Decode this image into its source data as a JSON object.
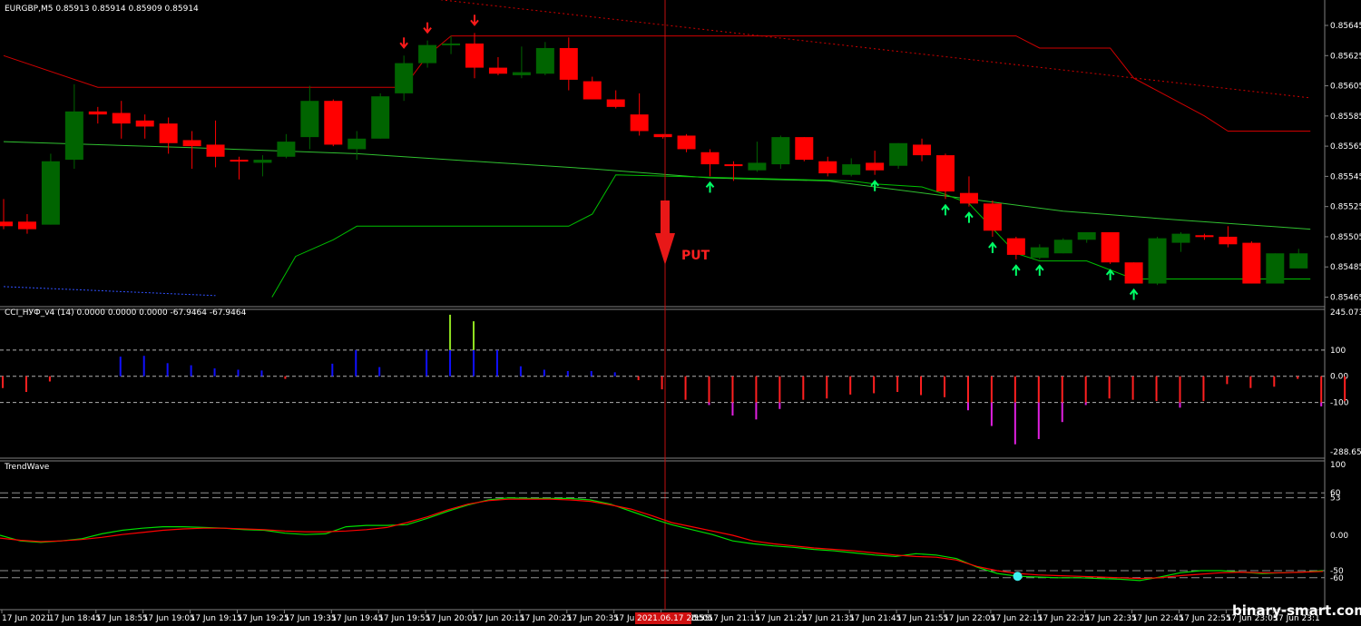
{
  "chart_data": [
    {
      "type": "candlestick",
      "title": "EURGBP,M5  0.85913 0.85914 0.85909 0.85914",
      "ylim": [
        0.85465,
        0.85645
      ],
      "y_ticks": [
        "0.85645",
        "0.85625",
        "0.85605",
        "0.85585",
        "0.85565",
        "0.85545",
        "0.85525",
        "0.85505",
        "0.85485",
        "0.85465"
      ],
      "colors": {
        "bull": "#006400",
        "bear": "#ff0000",
        "upper_band": "#d00000",
        "lower_band": "#00c000",
        "ma": "#30c030",
        "arrow_up": "#00ff66",
        "arrow_down": "#ff1a1a"
      },
      "candles": [
        {
          "o": 0.85515,
          "h": 0.8553,
          "l": 0.8551,
          "c": 0.85512
        },
        {
          "o": 0.85515,
          "h": 0.8552,
          "l": 0.85507,
          "c": 0.8551
        },
        {
          "o": 0.85513,
          "h": 0.8556,
          "l": 0.85513,
          "c": 0.85555
        },
        {
          "o": 0.85556,
          "h": 0.85606,
          "l": 0.8555,
          "c": 0.85588
        },
        {
          "o": 0.85588,
          "h": 0.85591,
          "l": 0.8558,
          "c": 0.85586
        },
        {
          "o": 0.85587,
          "h": 0.85595,
          "l": 0.8557,
          "c": 0.8558
        },
        {
          "o": 0.85582,
          "h": 0.85586,
          "l": 0.8557,
          "c": 0.85578
        },
        {
          "o": 0.8558,
          "h": 0.85584,
          "l": 0.8556,
          "c": 0.85567
        },
        {
          "o": 0.85569,
          "h": 0.85575,
          "l": 0.8555,
          "c": 0.85565
        },
        {
          "o": 0.85566,
          "h": 0.85582,
          "l": 0.85551,
          "c": 0.85558
        },
        {
          "o": 0.85556,
          "h": 0.85558,
          "l": 0.85543,
          "c": 0.85555
        },
        {
          "o": 0.85554,
          "h": 0.85559,
          "l": 0.85545,
          "c": 0.85556
        },
        {
          "o": 0.85558,
          "h": 0.85573,
          "l": 0.85557,
          "c": 0.85568
        },
        {
          "o": 0.85571,
          "h": 0.85605,
          "l": 0.85563,
          "c": 0.85595
        },
        {
          "o": 0.85595,
          "h": 0.85596,
          "l": 0.85565,
          "c": 0.85566
        },
        {
          "o": 0.85563,
          "h": 0.85575,
          "l": 0.85556,
          "c": 0.8557
        },
        {
          "o": 0.8557,
          "h": 0.856,
          "l": 0.8557,
          "c": 0.85598
        },
        {
          "o": 0.856,
          "h": 0.85625,
          "l": 0.85595,
          "c": 0.8562
        },
        {
          "o": 0.8562,
          "h": 0.85635,
          "l": 0.85617,
          "c": 0.85632
        },
        {
          "o": 0.85632,
          "h": 0.85638,
          "l": 0.85626,
          "c": 0.85633
        },
        {
          "o": 0.85633,
          "h": 0.8564,
          "l": 0.8561,
          "c": 0.85617
        },
        {
          "o": 0.85617,
          "h": 0.85624,
          "l": 0.85612,
          "c": 0.85613
        },
        {
          "o": 0.85612,
          "h": 0.85631,
          "l": 0.8561,
          "c": 0.85614
        },
        {
          "o": 0.85613,
          "h": 0.85634,
          "l": 0.85612,
          "c": 0.8563
        },
        {
          "o": 0.8563,
          "h": 0.85637,
          "l": 0.85602,
          "c": 0.85609
        },
        {
          "o": 0.85608,
          "h": 0.85611,
          "l": 0.85596,
          "c": 0.85596
        },
        {
          "o": 0.85596,
          "h": 0.85602,
          "l": 0.8559,
          "c": 0.85591
        },
        {
          "o": 0.85586,
          "h": 0.856,
          "l": 0.85572,
          "c": 0.85575
        },
        {
          "o": 0.85573,
          "h": 0.85573,
          "l": 0.8557,
          "c": 0.85571
        },
        {
          "o": 0.85572,
          "h": 0.85573,
          "l": 0.85561,
          "c": 0.85563
        },
        {
          "o": 0.85561,
          "h": 0.85563,
          "l": 0.85545,
          "c": 0.85553
        },
        {
          "o": 0.85553,
          "h": 0.85555,
          "l": 0.85542,
          "c": 0.85552
        },
        {
          "o": 0.85549,
          "h": 0.85568,
          "l": 0.85548,
          "c": 0.85554
        },
        {
          "o": 0.85553,
          "h": 0.85572,
          "l": 0.8555,
          "c": 0.85571
        },
        {
          "o": 0.85571,
          "h": 0.85571,
          "l": 0.85555,
          "c": 0.85556
        },
        {
          "o": 0.85555,
          "h": 0.85558,
          "l": 0.85545,
          "c": 0.85547
        },
        {
          "o": 0.85546,
          "h": 0.85557,
          "l": 0.85545,
          "c": 0.85553
        },
        {
          "o": 0.85554,
          "h": 0.85562,
          "l": 0.85546,
          "c": 0.85549
        },
        {
          "o": 0.85552,
          "h": 0.85567,
          "l": 0.8555,
          "c": 0.85567
        },
        {
          "o": 0.85566,
          "h": 0.8557,
          "l": 0.85555,
          "c": 0.85559
        },
        {
          "o": 0.85559,
          "h": 0.8556,
          "l": 0.8553,
          "c": 0.85535
        },
        {
          "o": 0.85534,
          "h": 0.85545,
          "l": 0.85525,
          "c": 0.85527
        },
        {
          "o": 0.85527,
          "h": 0.85529,
          "l": 0.85505,
          "c": 0.85509
        },
        {
          "o": 0.85504,
          "h": 0.85505,
          "l": 0.8549,
          "c": 0.85493
        },
        {
          "o": 0.85491,
          "h": 0.855,
          "l": 0.8549,
          "c": 0.85498
        },
        {
          "o": 0.85494,
          "h": 0.85504,
          "l": 0.85494,
          "c": 0.85503
        },
        {
          "o": 0.85503,
          "h": 0.85508,
          "l": 0.85501,
          "c": 0.85508
        },
        {
          "o": 0.85508,
          "h": 0.85508,
          "l": 0.85487,
          "c": 0.85488
        },
        {
          "o": 0.85488,
          "h": 0.85488,
          "l": 0.85474,
          "c": 0.85474
        },
        {
          "o": 0.85474,
          "h": 0.85505,
          "l": 0.85473,
          "c": 0.85504
        },
        {
          "o": 0.85501,
          "h": 0.85508,
          "l": 0.85495,
          "c": 0.85507
        },
        {
          "o": 0.85506,
          "h": 0.85507,
          "l": 0.85503,
          "c": 0.85505
        },
        {
          "o": 0.85505,
          "h": 0.85512,
          "l": 0.85498,
          "c": 0.855
        },
        {
          "o": 0.85501,
          "h": 0.85502,
          "l": 0.85474,
          "c": 0.85474
        },
        {
          "o": 0.85474,
          "h": 0.85494,
          "l": 0.85474,
          "c": 0.85494
        },
        {
          "o": 0.85484,
          "h": 0.85497,
          "l": 0.85484,
          "c": 0.85494
        }
      ],
      "upper_band": [
        [
          0,
          0.85625
        ],
        [
          4,
          0.85604
        ],
        [
          17,
          0.85604
        ],
        [
          18,
          0.85625
        ],
        [
          19,
          0.85638
        ],
        [
          43,
          0.85638
        ],
        [
          44,
          0.8563
        ],
        [
          47,
          0.8563
        ],
        [
          48,
          0.8561
        ],
        [
          51,
          0.85585
        ],
        [
          52,
          0.85575
        ],
        [
          55.5,
          0.85575
        ]
      ],
      "upper_dotted": [
        [
          18,
          0.85663
        ],
        [
          55.5,
          0.85597
        ]
      ],
      "lower_band": [
        [
          11.4,
          0.85465
        ],
        [
          12.4,
          0.85492
        ],
        [
          14,
          0.85503
        ],
        [
          15,
          0.85512
        ],
        [
          24,
          0.85512
        ],
        [
          25,
          0.8552
        ],
        [
          26,
          0.85546
        ],
        [
          36,
          0.85542
        ],
        [
          37,
          0.8554
        ],
        [
          39,
          0.85538
        ],
        [
          40,
          0.85533
        ],
        [
          41,
          0.85527
        ],
        [
          43,
          0.85494
        ],
        [
          44,
          0.85489
        ],
        [
          46,
          0.85489
        ],
        [
          48,
          0.85477
        ],
        [
          55.5,
          0.85477
        ]
      ],
      "ma_line": [
        [
          0,
          0.85568
        ],
        [
          8,
          0.85564
        ],
        [
          15,
          0.8556
        ],
        [
          20,
          0.85555
        ],
        [
          25,
          0.8555
        ],
        [
          30,
          0.85544
        ],
        [
          35,
          0.85542
        ],
        [
          40,
          0.85532
        ],
        [
          45,
          0.85522
        ],
        [
          50,
          0.85516
        ],
        [
          55.5,
          0.8551
        ]
      ],
      "blue_dotted": [
        [
          0,
          0.85472
        ],
        [
          9,
          0.85466
        ]
      ],
      "down_arrows": [
        17,
        18,
        20
      ],
      "up_arrows": [
        30,
        37,
        40,
        41,
        42,
        43,
        44,
        47,
        48
      ],
      "signal": {
        "label": "PUT",
        "x_index": 28
      }
    },
    {
      "type": "bar",
      "title": "CCI_НУФ_v4 (14) 0.0000 0.0000 0.0000 -67.9464 -67.9464",
      "ylim": [
        -288.659,
        245.0736
      ],
      "y_ticks": [
        "245.0736",
        "100",
        "0.00",
        "-100",
        "-288.659"
      ],
      "values": [
        -45,
        -60,
        -20,
        0,
        0,
        75,
        78,
        50,
        42,
        30,
        25,
        22,
        -10,
        0,
        48,
        100,
        35,
        0,
        100,
        235,
        210,
        100,
        38,
        25,
        20,
        20,
        15,
        -15,
        -50,
        -90,
        -110,
        -150,
        -165,
        -125,
        -90,
        -85,
        -70,
        -65,
        -60,
        -72,
        -80,
        -130,
        -190,
        -260,
        -240,
        -175,
        -110,
        -85,
        -90,
        -95,
        -120,
        -95,
        -30,
        -45,
        -40,
        -10,
        -115,
        -95,
        -30,
        -60
      ],
      "colors": {
        "positive": "#1010ff",
        "strong_positive": "#90e020",
        "negative": "#ff2020",
        "strong_negative": "#e020e0"
      }
    },
    {
      "type": "line",
      "title": "TrendWave",
      "ylim": [
        -100,
        100
      ],
      "y_ticks": [
        "100",
        "60",
        "53",
        "0.00",
        "-50",
        "-60"
      ],
      "series": [
        {
          "name": "",
          "color": "#00dd00",
          "values": [
            0,
            -8,
            -10,
            -8,
            -5,
            2,
            7,
            10,
            12,
            12,
            11,
            10,
            8,
            7,
            3,
            1,
            2,
            12,
            14,
            14,
            15,
            24,
            34,
            43,
            50,
            53,
            52,
            52,
            52,
            50,
            44,
            34,
            24,
            15,
            8,
            1,
            -8,
            -12,
            -15,
            -17,
            -20,
            -22,
            -25,
            -28,
            -30,
            -26,
            -28,
            -33,
            -45,
            -54,
            -58,
            -59,
            -60,
            -60,
            -61,
            -62,
            -64,
            -59,
            -53,
            -50,
            -50,
            -52,
            -54,
            -53,
            -52,
            -50
          ]
        },
        {
          "name": "",
          "color": "#ff0000",
          "values": [
            -4,
            -7,
            -9,
            -8,
            -6,
            -3,
            1,
            4,
            7,
            9,
            10,
            10,
            9,
            8,
            6,
            5,
            5,
            6,
            8,
            11,
            18,
            26,
            36,
            44,
            49,
            51,
            51,
            51,
            50,
            48,
            43,
            37,
            28,
            18,
            12,
            6,
            0,
            -8,
            -12,
            -15,
            -18,
            -20,
            -22,
            -25,
            -28,
            -30,
            -31,
            -35,
            -44,
            -50,
            -54,
            -56,
            -57,
            -58,
            -59,
            -60,
            -61,
            -60,
            -57,
            -55,
            -53,
            -52,
            -53,
            -53,
            -52,
            -51
          ]
        },
        {
          "name": "",
          "color": "#808080",
          "values": []
        }
      ],
      "signal_dot_index": 50,
      "signal_dot_color": "#40f0f0"
    }
  ],
  "x_axis": {
    "ticks": [
      "17 Jun 2021",
      "17 Jun 18:45",
      "17 Jun 18:55",
      "17 Jun 19:05",
      "17 Jun 19:15",
      "17 Jun 19:25",
      "17 Jun 19:35",
      "17 Jun 19:45",
      "17 Jun 19:55",
      "17 Jun 20:05",
      "17 Jun 20:15",
      "17 Jun 20:25",
      "17 Jun 20:35",
      "17 Jun",
      "17 Jun 21:05",
      "17 Jun 21:15",
      "17 Jun 21:25",
      "17 Jun 21:35",
      "17 Jun 21:45",
      "17 Jun 21:55",
      "17 Jun 22:05",
      "17 Jun 22:15",
      "17 Jun 22:25",
      "17 Jun 22:35",
      "17 Jun 22:45",
      "17 Jun 22:55",
      "17 Jun 23:05",
      "17 Jun 23:1"
    ],
    "highlight_label": "2021.06.17 20:55",
    "highlight_suffix": "55"
  },
  "watermark": "binary-smart.com"
}
